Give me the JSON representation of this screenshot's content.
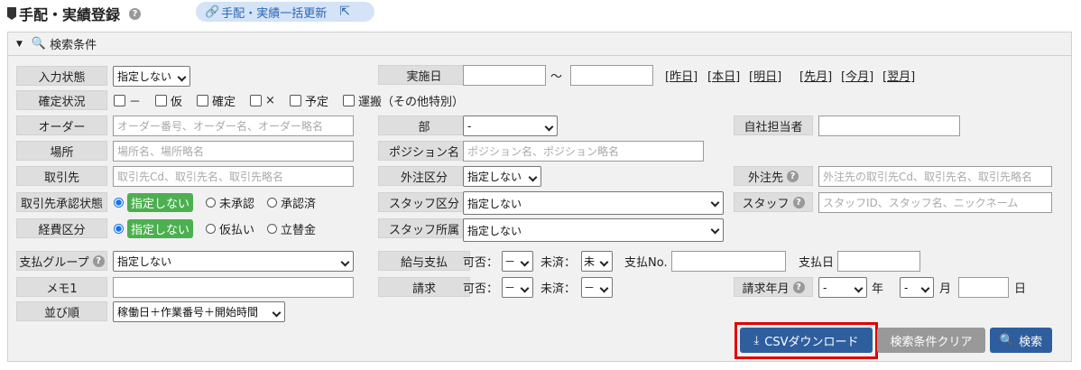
{
  "header": {
    "title": "手配・実績登録",
    "bulk_link": "手配・実績一括更新"
  },
  "panel": {
    "title": "検索条件"
  },
  "labels": {
    "input_state": "入力状態",
    "confirm_state": "確定状況",
    "order": "オーダー",
    "place": "場所",
    "client": "取引先",
    "client_approval": "取引先承認状態",
    "expense": "経費区分",
    "pay_group": "支払グループ",
    "memo": "メモ1",
    "sort": "並び順",
    "date": "実施日",
    "dept": "部",
    "position": "ポジション名",
    "outsource_type": "外注区分",
    "staff_type": "スタッフ区分",
    "staff_affil": "スタッフ所属",
    "salary": "給与支払",
    "billing": "請求",
    "own_staff": "自社担当者",
    "outsourcer": "外注先",
    "staff": "スタッフ",
    "bill_ym": "請求年月"
  },
  "values": {
    "input_state": "指定しない",
    "dept": "-",
    "outsource_type": "指定しない",
    "staff_type": "指定しない",
    "staff_affil": "指定しない",
    "pay_group": "指定しない",
    "sort": "稼働日＋作業番号＋開始時間",
    "salary_ok": "－",
    "salary_done": "未",
    "billing_ok": "－",
    "billing_done": "－",
    "year": "-",
    "month": "-"
  },
  "placeholders": {
    "order": "オーダー番号、オーダー名、オーダー略名",
    "place": "場所名、場所略名",
    "client": "取引先Cd、取引先名、取引先略名",
    "position": "ポジション名、ポジション略名",
    "outsourcer": "外注先の取引先Cd、取引先名、取引先略名",
    "staff": "スタッフID、スタッフ名、ニックネーム"
  },
  "confirm_options": [
    "－",
    "仮",
    "確定",
    "×",
    "予定",
    "運搬（その他特別）"
  ],
  "approval_options": [
    "指定しない",
    "未承認",
    "承認済"
  ],
  "expense_options": [
    "指定しない",
    "仮払い",
    "立替金"
  ],
  "date_links": [
    "[昨日]",
    "[本日]",
    "[明日]",
    "[先月]",
    "[今月]",
    "[翌月]"
  ],
  "inline": {
    "tilde": "～",
    "ok": "可否：",
    "done": "未済：",
    "pay_no": "支払No.",
    "pay_date": "支払日",
    "year": "年",
    "month": "月",
    "day": "日"
  },
  "buttons": {
    "csv": "CSVダウンロード",
    "clear": "検索条件クリア",
    "search": "検索"
  },
  "colors": {
    "primary": "#2e5e9e",
    "clear": "#999999",
    "highlight": "#e00000",
    "link_bg": "#d4e3f6"
  }
}
